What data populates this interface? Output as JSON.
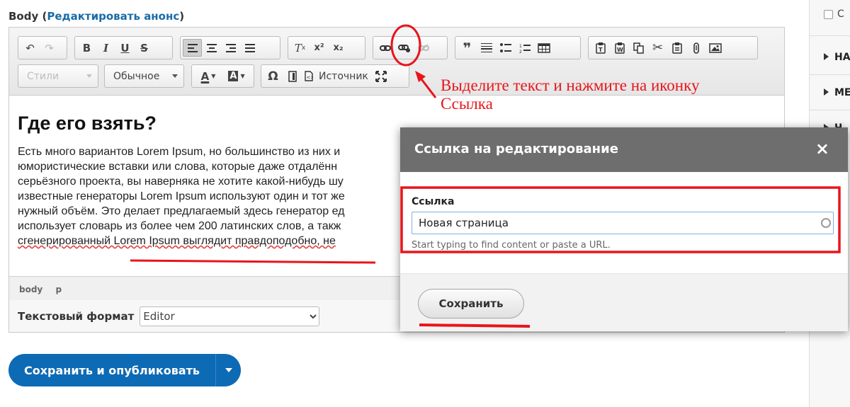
{
  "field": {
    "label": "Body",
    "link": "Редактировать анонс"
  },
  "toolbar": {
    "row1": [
      {
        "name": "undo-icon",
        "glyph": "↶"
      },
      {
        "name": "redo-icon",
        "glyph": "↷",
        "disabled": true
      },
      {
        "name": "bold-icon",
        "glyph": "B"
      },
      {
        "name": "italic-icon",
        "glyph": "I"
      },
      {
        "name": "underline-icon",
        "glyph": "U"
      },
      {
        "name": "strikethrough-icon",
        "glyph": "S"
      },
      {
        "name": "align-left-icon",
        "glyph": "≡"
      },
      {
        "name": "align-center-icon",
        "glyph": "≡"
      },
      {
        "name": "align-right-icon",
        "glyph": "≡"
      },
      {
        "name": "align-justify-icon",
        "glyph": "≡"
      },
      {
        "name": "remove-format-icon",
        "glyph": "Tx"
      },
      {
        "name": "superscript-icon",
        "glyph": "x²"
      },
      {
        "name": "subscript-icon",
        "glyph": "x₂"
      },
      {
        "name": "link-icon",
        "glyph": "⛓"
      },
      {
        "name": "edit-link-icon",
        "glyph": "⛓"
      },
      {
        "name": "unlink-icon",
        "glyph": "⛓",
        "disabled": true
      },
      {
        "name": "blockquote-icon",
        "glyph": "❞"
      },
      {
        "name": "horizontal-rule-icon",
        "glyph": "☰"
      },
      {
        "name": "bulleted-list-icon",
        "glyph": "☷"
      },
      {
        "name": "numbered-list-icon",
        "glyph": "☷"
      },
      {
        "name": "table-icon",
        "glyph": "▦"
      },
      {
        "name": "paste-text-icon",
        "glyph": "📋"
      },
      {
        "name": "paste-word-icon",
        "glyph": "📋"
      },
      {
        "name": "copy-icon",
        "glyph": "❐"
      },
      {
        "name": "cut-icon",
        "glyph": "✂"
      },
      {
        "name": "paste-icon",
        "glyph": "📋"
      },
      {
        "name": "attach-icon",
        "glyph": "📎"
      },
      {
        "name": "image-icon",
        "glyph": "▣"
      }
    ],
    "styles_placeholder": "Стили",
    "format_value": "Обычное",
    "source_label": "Источник"
  },
  "content": {
    "heading": "Где его взять?",
    "lines": [
      "Есть много вариантов Lorem Ipsum, но большинство из них и",
      "юмористические вставки или слова, которые даже отдалённ",
      "серьёзного проекта, вы наверняка не хотите какой-нибудь шу",
      "известные генераторы Lorem Ipsum используют один и тот же",
      "нужный объём. Это делает предлагаемый здесь генератор ед",
      "использует словарь из более чем 200 латинских слов, а такж",
      "сгенерированный Lorem Ipsum выглядит правдоподобно, не"
    ]
  },
  "pathbar": [
    "body",
    "p"
  ],
  "text_format": {
    "label": "Текстовый формат",
    "value": "Editor"
  },
  "publish": {
    "label": "Сохранить и опубликовать"
  },
  "sidebar": {
    "checkbox_label": "С",
    "items": [
      "НА",
      "МЕ",
      "Ч"
    ]
  },
  "modal": {
    "title": "Ссылка на редактирование",
    "close": "×",
    "field_label": "Ссылка",
    "input_value": "Новая страница",
    "help": "Start typing to find content or paste a URL.",
    "save_label": "Сохранить"
  },
  "annotation": {
    "line1": "Выделите текст и нажмите на иконку",
    "line2": "Ссылка",
    "color": "#e8151b"
  }
}
